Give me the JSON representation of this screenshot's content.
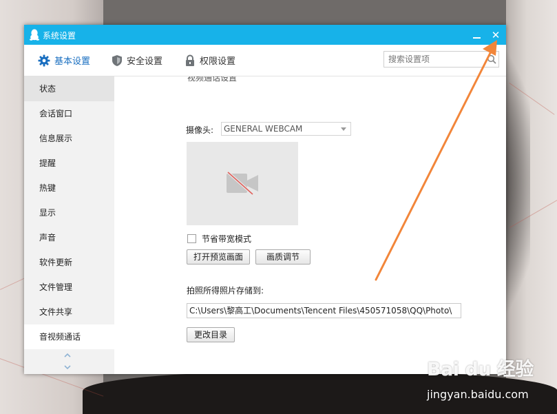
{
  "window": {
    "title": "系统设置",
    "minimize_glyph": "minimize-icon",
    "close_glyph": "✕"
  },
  "tabs": [
    {
      "label": "基本设置",
      "icon": "gear-icon",
      "active": true
    },
    {
      "label": "安全设置",
      "icon": "shield-icon",
      "active": false
    },
    {
      "label": "权限设置",
      "icon": "lock-icon",
      "active": false
    }
  ],
  "search": {
    "placeholder": "搜索设置项",
    "icon": "search-icon"
  },
  "sidebar": {
    "items": [
      {
        "label": "状态"
      },
      {
        "label": "会话窗口"
      },
      {
        "label": "信息展示"
      },
      {
        "label": "提醒"
      },
      {
        "label": "热键"
      },
      {
        "label": "显示"
      },
      {
        "label": "声音"
      },
      {
        "label": "软件更新"
      },
      {
        "label": "文件管理"
      },
      {
        "label": "文件共享"
      },
      {
        "label": "音视频通话"
      }
    ],
    "scroll_up_icon": "chevron-up-icon",
    "scroll_down_icon": "chevron-down-icon"
  },
  "content": {
    "cut_text": "视频通话设置",
    "camera_label": "摄像头:",
    "camera_value": "GENERAL WEBCAM",
    "preview_icon": "camera-off-icon",
    "bandwidth_label": "节省带宽模式",
    "open_preview_button": "打开预览画面",
    "quality_button": "画质调节",
    "save_label": "拍照所得照片存储到:",
    "save_path": "C:\\Users\\黎高工\\Documents\\Tencent Files\\450571058\\QQ\\Photo\\",
    "change_dir_button": "更改目录"
  },
  "watermark": {
    "logo": "Bai du 经验",
    "url": "jingyan.baidu.com"
  },
  "colors": {
    "titlebar": "#17b2e9",
    "active_tab": "#1a6fc0",
    "annotation_arrow": "#f2863a"
  }
}
